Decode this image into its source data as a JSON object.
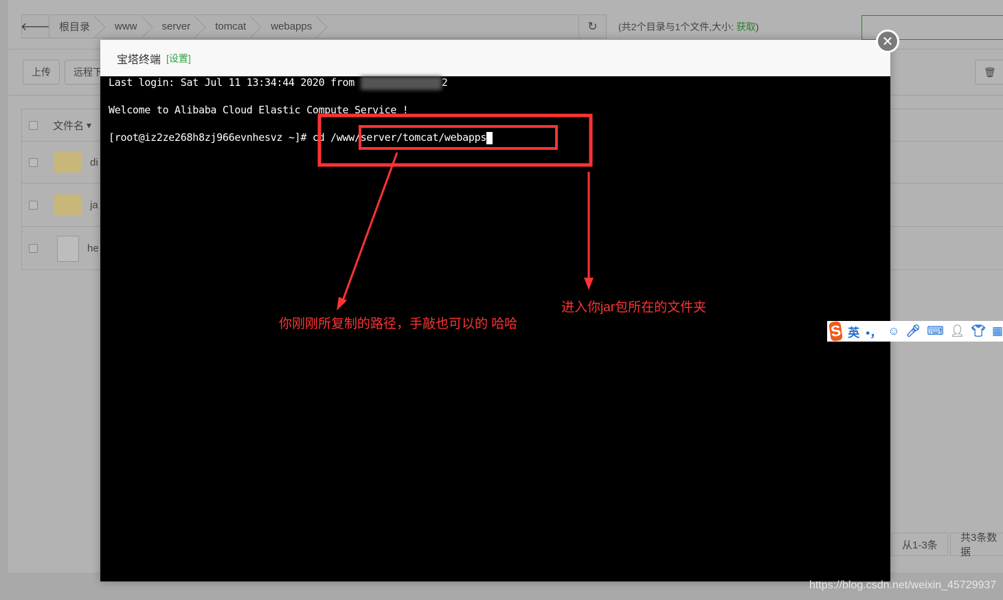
{
  "breadcrumb": {
    "items": [
      "根目录",
      "www",
      "server",
      "tomcat",
      "webapps"
    ]
  },
  "info": {
    "prefix": "(共2个目录与1个文件,大小: ",
    "link": "获取",
    "suffix": ")"
  },
  "toolbar": {
    "upload": "上传",
    "remote": "远程下"
  },
  "table": {
    "header": "文件名",
    "rows": [
      {
        "name": "di",
        "type": "folder"
      },
      {
        "name": "ja",
        "type": "folder"
      },
      {
        "name": "he",
        "type": "file"
      }
    ]
  },
  "pager": {
    "range": "从1-3条",
    "total": "共3条数据"
  },
  "modal": {
    "title": "宝塔终端",
    "settings": "[设置]"
  },
  "terminal": {
    "line1": "Last login: Sat Jul 11 13:34:44 2020 from ",
    "line1_end": "2",
    "line2": "Welcome to Alibaba Cloud Elastic Compute Service !",
    "prompt": "[root@iz2ze268h8zj966evnhesvz ~]# cd ",
    "command": "/www/server/tomcat/webapps"
  },
  "annotations": {
    "left": "你刚刚所复制的路径，手敲也可以的  哈哈",
    "right": "进入你jar包所在的文件夹",
    "color": "#ff3333"
  },
  "ime": {
    "mode": "英",
    "punct": "•，"
  },
  "watermark": "https://blog.csdn.net/weixin_45729937"
}
